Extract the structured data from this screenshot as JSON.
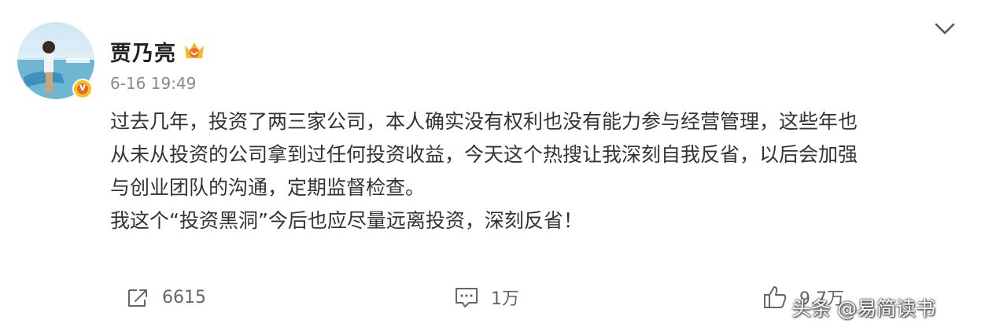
{
  "user": {
    "name": "贾乃亮",
    "verified_symbol": "v"
  },
  "post": {
    "time": "6-16 19:49",
    "lines": [
      "过去几年，投资了两三家公司，本人确实没有权利也没有能力参与经营管理，这些年也",
      "从未从投资的公司拿到过任何投资收益，今天这个热搜让我深刻自我反省，以后会加强",
      "与创业团队的沟通，定期监督检查。",
      "我这个“投资黑洞”今后也应尽量远离投资，深刻反省！"
    ]
  },
  "actions": {
    "repost_count": "6615",
    "comment_count": "1万",
    "like_count": "9.7万"
  },
  "watermark": "头条 @易简读书",
  "colors": {
    "text": "#333333",
    "meta": "#8a8a8a",
    "badge_orange": "#e8692a",
    "badge_yellow": "#f7c31f"
  },
  "icons": [
    "repost-icon",
    "comment-icon",
    "like-icon",
    "chevron-down-icon",
    "vip-crown-icon"
  ]
}
